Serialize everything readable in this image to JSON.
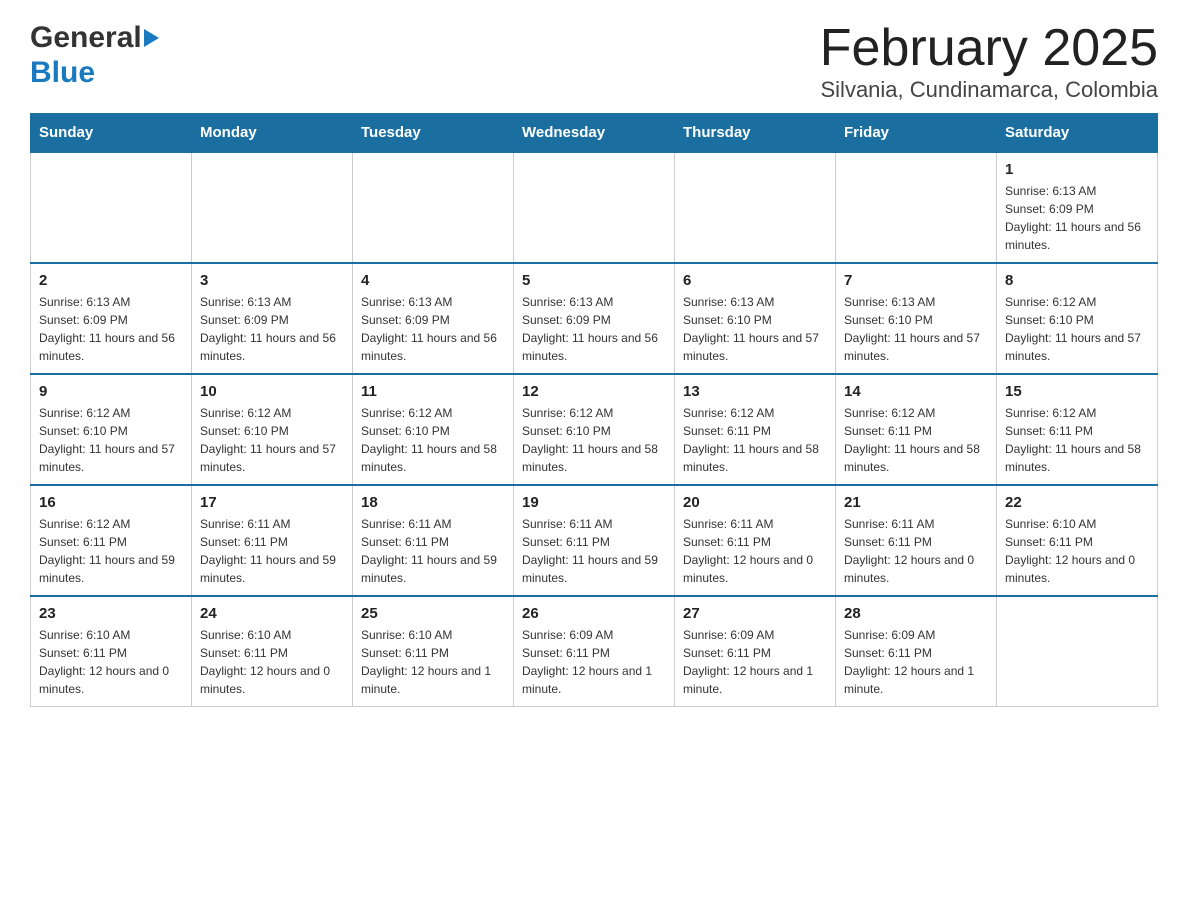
{
  "header": {
    "logo_general": "General",
    "logo_blue": "Blue",
    "title": "February 2025",
    "subtitle": "Silvania, Cundinamarca, Colombia"
  },
  "calendar": {
    "days_of_week": [
      "Sunday",
      "Monday",
      "Tuesday",
      "Wednesday",
      "Thursday",
      "Friday",
      "Saturday"
    ],
    "weeks": [
      [
        {
          "day": "",
          "info": ""
        },
        {
          "day": "",
          "info": ""
        },
        {
          "day": "",
          "info": ""
        },
        {
          "day": "",
          "info": ""
        },
        {
          "day": "",
          "info": ""
        },
        {
          "day": "",
          "info": ""
        },
        {
          "day": "1",
          "info": "Sunrise: 6:13 AM\nSunset: 6:09 PM\nDaylight: 11 hours and 56 minutes."
        }
      ],
      [
        {
          "day": "2",
          "info": "Sunrise: 6:13 AM\nSunset: 6:09 PM\nDaylight: 11 hours and 56 minutes."
        },
        {
          "day": "3",
          "info": "Sunrise: 6:13 AM\nSunset: 6:09 PM\nDaylight: 11 hours and 56 minutes."
        },
        {
          "day": "4",
          "info": "Sunrise: 6:13 AM\nSunset: 6:09 PM\nDaylight: 11 hours and 56 minutes."
        },
        {
          "day": "5",
          "info": "Sunrise: 6:13 AM\nSunset: 6:09 PM\nDaylight: 11 hours and 56 minutes."
        },
        {
          "day": "6",
          "info": "Sunrise: 6:13 AM\nSunset: 6:10 PM\nDaylight: 11 hours and 57 minutes."
        },
        {
          "day": "7",
          "info": "Sunrise: 6:13 AM\nSunset: 6:10 PM\nDaylight: 11 hours and 57 minutes."
        },
        {
          "day": "8",
          "info": "Sunrise: 6:12 AM\nSunset: 6:10 PM\nDaylight: 11 hours and 57 minutes."
        }
      ],
      [
        {
          "day": "9",
          "info": "Sunrise: 6:12 AM\nSunset: 6:10 PM\nDaylight: 11 hours and 57 minutes."
        },
        {
          "day": "10",
          "info": "Sunrise: 6:12 AM\nSunset: 6:10 PM\nDaylight: 11 hours and 57 minutes."
        },
        {
          "day": "11",
          "info": "Sunrise: 6:12 AM\nSunset: 6:10 PM\nDaylight: 11 hours and 58 minutes."
        },
        {
          "day": "12",
          "info": "Sunrise: 6:12 AM\nSunset: 6:10 PM\nDaylight: 11 hours and 58 minutes."
        },
        {
          "day": "13",
          "info": "Sunrise: 6:12 AM\nSunset: 6:11 PM\nDaylight: 11 hours and 58 minutes."
        },
        {
          "day": "14",
          "info": "Sunrise: 6:12 AM\nSunset: 6:11 PM\nDaylight: 11 hours and 58 minutes."
        },
        {
          "day": "15",
          "info": "Sunrise: 6:12 AM\nSunset: 6:11 PM\nDaylight: 11 hours and 58 minutes."
        }
      ],
      [
        {
          "day": "16",
          "info": "Sunrise: 6:12 AM\nSunset: 6:11 PM\nDaylight: 11 hours and 59 minutes."
        },
        {
          "day": "17",
          "info": "Sunrise: 6:11 AM\nSunset: 6:11 PM\nDaylight: 11 hours and 59 minutes."
        },
        {
          "day": "18",
          "info": "Sunrise: 6:11 AM\nSunset: 6:11 PM\nDaylight: 11 hours and 59 minutes."
        },
        {
          "day": "19",
          "info": "Sunrise: 6:11 AM\nSunset: 6:11 PM\nDaylight: 11 hours and 59 minutes."
        },
        {
          "day": "20",
          "info": "Sunrise: 6:11 AM\nSunset: 6:11 PM\nDaylight: 12 hours and 0 minutes."
        },
        {
          "day": "21",
          "info": "Sunrise: 6:11 AM\nSunset: 6:11 PM\nDaylight: 12 hours and 0 minutes."
        },
        {
          "day": "22",
          "info": "Sunrise: 6:10 AM\nSunset: 6:11 PM\nDaylight: 12 hours and 0 minutes."
        }
      ],
      [
        {
          "day": "23",
          "info": "Sunrise: 6:10 AM\nSunset: 6:11 PM\nDaylight: 12 hours and 0 minutes."
        },
        {
          "day": "24",
          "info": "Sunrise: 6:10 AM\nSunset: 6:11 PM\nDaylight: 12 hours and 0 minutes."
        },
        {
          "day": "25",
          "info": "Sunrise: 6:10 AM\nSunset: 6:11 PM\nDaylight: 12 hours and 1 minute."
        },
        {
          "day": "26",
          "info": "Sunrise: 6:09 AM\nSunset: 6:11 PM\nDaylight: 12 hours and 1 minute."
        },
        {
          "day": "27",
          "info": "Sunrise: 6:09 AM\nSunset: 6:11 PM\nDaylight: 12 hours and 1 minute."
        },
        {
          "day": "28",
          "info": "Sunrise: 6:09 AM\nSunset: 6:11 PM\nDaylight: 12 hours and 1 minute."
        },
        {
          "day": "",
          "info": ""
        }
      ]
    ]
  }
}
